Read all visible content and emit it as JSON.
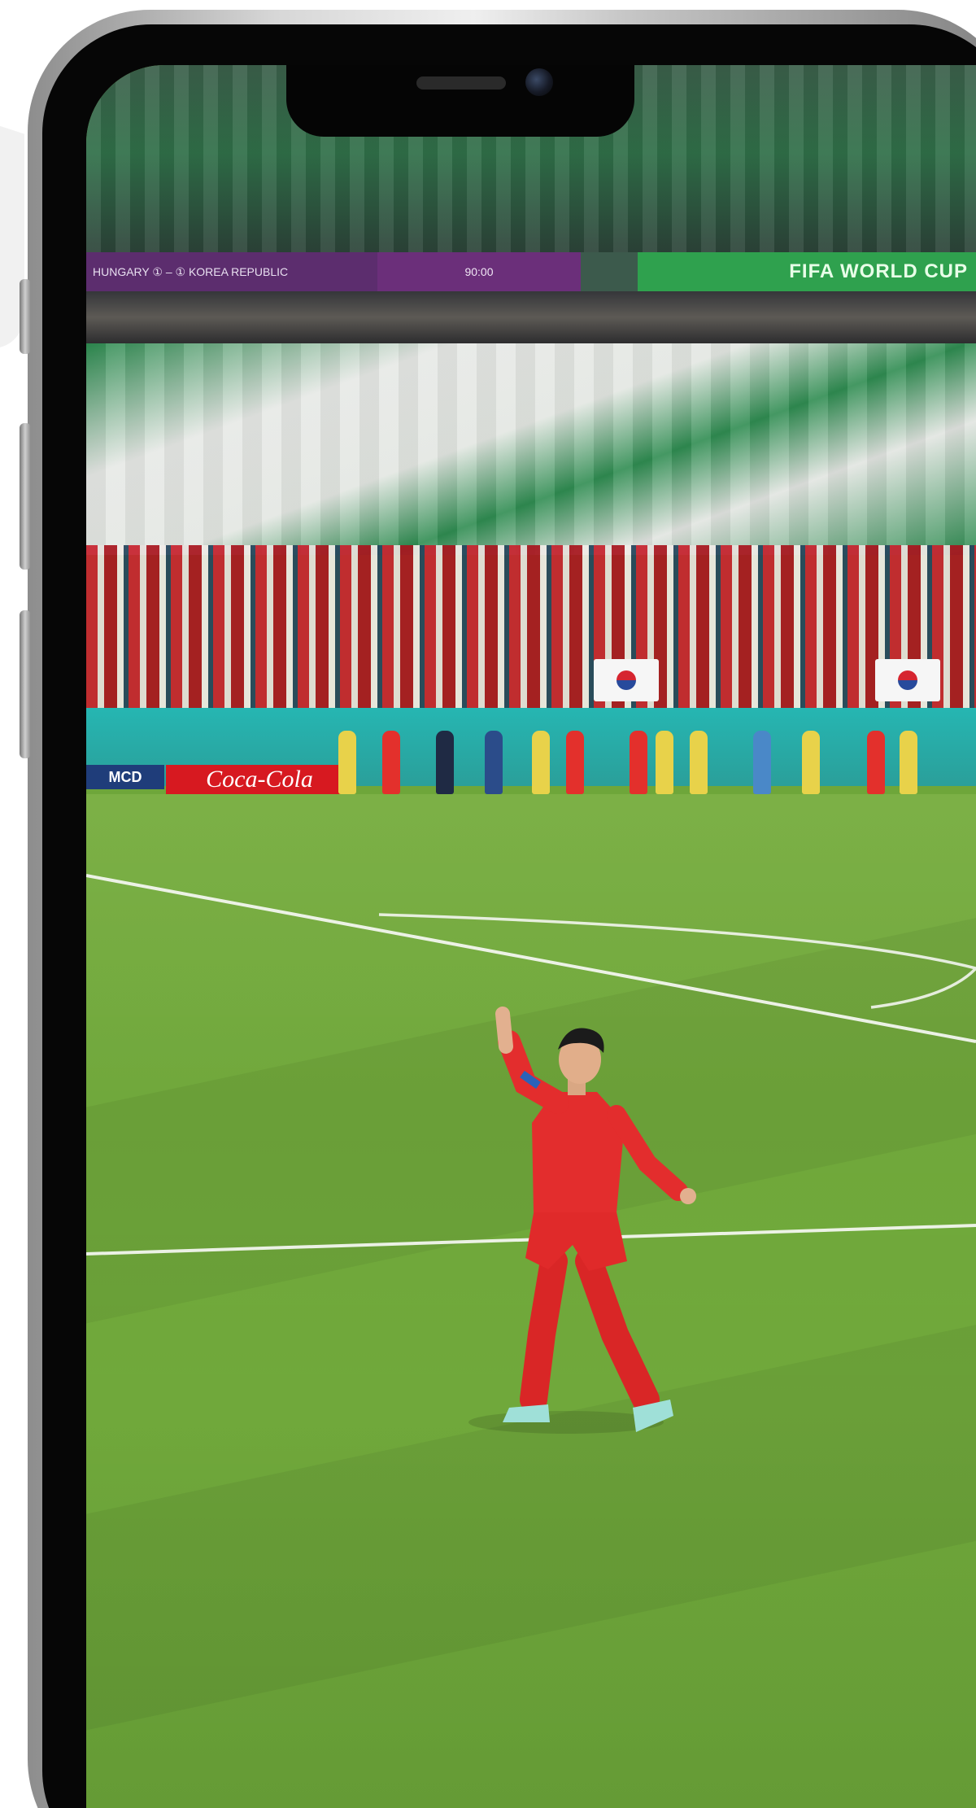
{
  "scene": {
    "banner": {
      "score_text": "HUNGARY ① – ① KOREA REPUBLIC",
      "clock_text": "90:00",
      "tournament_text": "FIFA WORLD CUP"
    },
    "ads": {
      "left_brand": "MCD",
      "coke_brand": "Coca-Cola"
    }
  },
  "colors": {
    "pitch": "#6fa73a",
    "jersey": "#e32d2d",
    "banner_purple": "#6b2f7a",
    "banner_green": "#2fa14e",
    "ad_board_teal": "#26b6b2"
  }
}
